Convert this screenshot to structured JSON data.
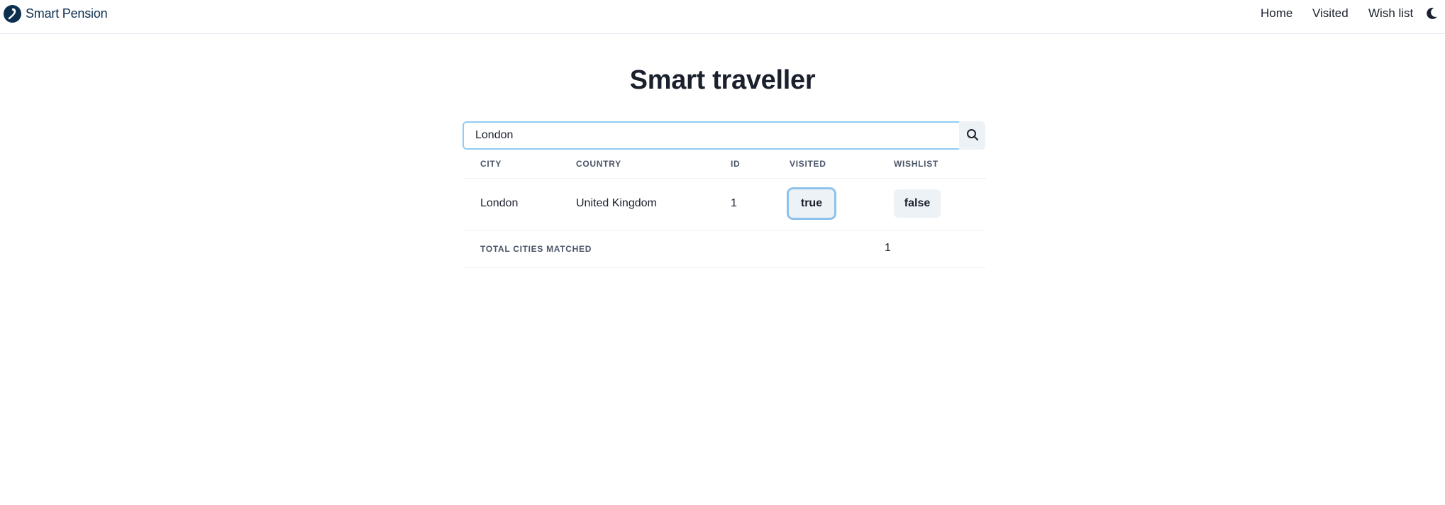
{
  "header": {
    "brand": "Smart Pension",
    "nav": {
      "home": "Home",
      "visited": "Visited",
      "wishlist": "Wish list"
    },
    "theme_icon": "moon-icon"
  },
  "page": {
    "title": "Smart traveller"
  },
  "search": {
    "value": "London",
    "icon": "search-icon"
  },
  "table": {
    "columns": [
      "CITY",
      "COUNTRY",
      "ID",
      "VISITED",
      "WISHLIST"
    ],
    "rows": [
      {
        "city": "London",
        "country": "United Kingdom",
        "id": "1",
        "visited": "true",
        "wishlist": "false"
      }
    ],
    "footer": {
      "label": "TOTAL CITIES MATCHED",
      "count": "1"
    }
  },
  "colors": {
    "brand": "#0d2f4f",
    "focus": "#90cdf4",
    "pill_bg": "#edf2f7"
  }
}
